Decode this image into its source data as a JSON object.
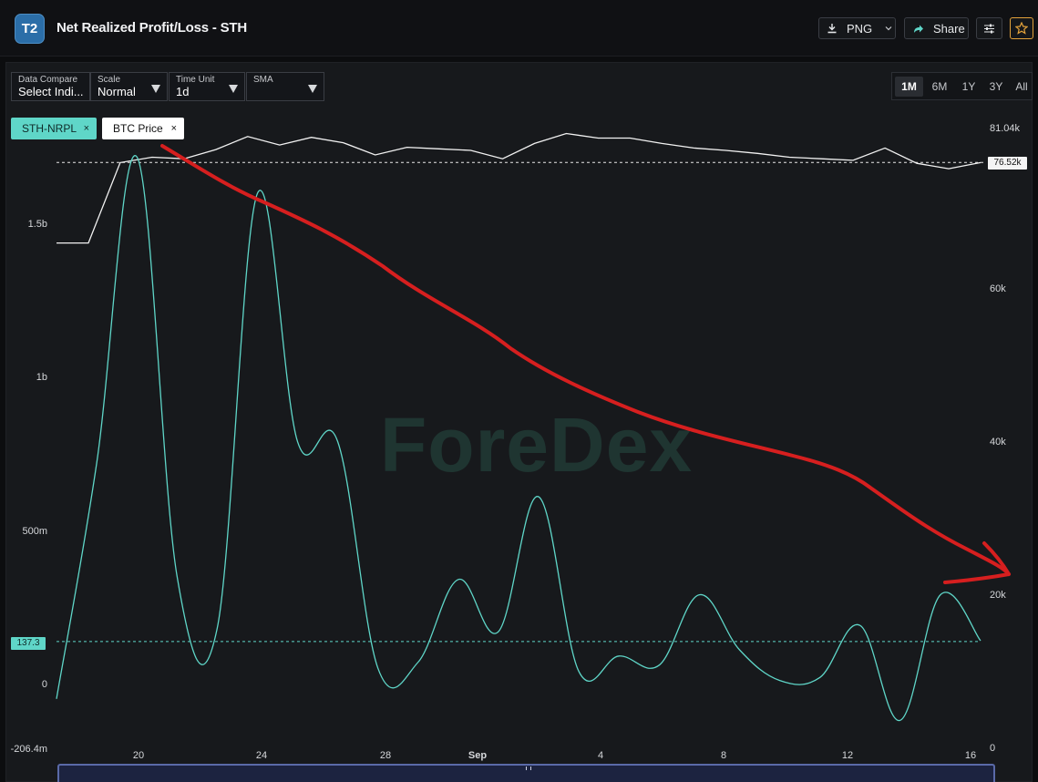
{
  "app": {
    "logo": "T2",
    "title": "Net Realized Profit/Loss - STH",
    "buttons": {
      "png": "PNG",
      "share": "Share"
    },
    "icons": [
      "download-icon",
      "chevron-down-icon",
      "share-arrow-icon",
      "settings-sliders-icon",
      "star-icon"
    ],
    "accent_color": "#e3a23b"
  },
  "controls": [
    {
      "label": "Data Compare",
      "value": "Select Indi..."
    },
    {
      "label": "Scale",
      "value": "Normal"
    },
    {
      "label": "Time Unit",
      "value": "1d"
    },
    {
      "label": "SMA",
      "value": ""
    }
  ],
  "ranges": {
    "options": [
      "1M",
      "6M",
      "1Y",
      "3Y",
      "All"
    ],
    "active": "1M"
  },
  "chips": [
    {
      "label": "STH-NRPL",
      "close": "×",
      "color": "#5fd6c8"
    },
    {
      "label": "BTC Price",
      "close": "×",
      "color": "#ffffff"
    }
  ],
  "watermark": "ForeDex",
  "chart_data": {
    "type": "line",
    "x": [
      "Aug 17",
      "Aug 18",
      "Aug 19",
      "Aug 20",
      "Aug 21",
      "Aug 22",
      "Aug 23",
      "Aug 24",
      "Aug 25",
      "Aug 26",
      "Aug 27",
      "Aug 28",
      "Aug 29",
      "Aug 30",
      "Aug 31",
      "Sep 1",
      "Sep 2",
      "Sep 3",
      "Sep 4",
      "Sep 5",
      "Sep 6",
      "Sep 7",
      "Sep 8",
      "Sep 9",
      "Sep 10",
      "Sep 11",
      "Sep 12",
      "Sep 13",
      "Sep 14",
      "Sep 15",
      "Sep 16"
    ],
    "xticks": [
      {
        "label": "20",
        "index": 3
      },
      {
        "label": "24",
        "index": 7
      },
      {
        "label": "28",
        "index": 11
      },
      {
        "label": "Sep",
        "index": 15
      },
      {
        "label": "4",
        "index": 18
      },
      {
        "label": "8",
        "index": 22
      },
      {
        "label": "12",
        "index": 26
      },
      {
        "label": "16",
        "index": 30
      }
    ],
    "series": [
      {
        "name": "STH-NRPL",
        "axis": "left",
        "color": "#5fd6c8",
        "values": [
          -0.05,
          0.72,
          1.72,
          0.35,
          0.18,
          1.6,
          0.79,
          0.79,
          0.05,
          0.07,
          0.34,
          0.17,
          0.61,
          0.04,
          0.09,
          0.06,
          0.29,
          0.11,
          0.01,
          0.02,
          0.19,
          -0.12,
          0.29,
          0.14
        ]
      },
      {
        "name": "BTC Price",
        "axis": "right",
        "color": "#ffffff",
        "values": [
          66000,
          66000,
          76500,
          77200,
          77000,
          78200,
          79900,
          78800,
          79800,
          79100,
          77500,
          78500,
          78300,
          78100,
          77000,
          79000,
          80300,
          79700,
          79700,
          79000,
          78400,
          78100,
          77700,
          77200,
          77000,
          76800,
          78400,
          76400,
          75700,
          76500
        ]
      }
    ],
    "left_axis": {
      "ticks": [
        "1.5b",
        "1b",
        "500m",
        "0",
        "-206.4m"
      ],
      "tick_values": [
        1500000000,
        1000000000,
        500000000,
        0,
        -206400000
      ],
      "ylim": [
        -206400000,
        1725000000
      ]
    },
    "right_axis": {
      "ticks": [
        "81.04k",
        "60k",
        "40k",
        "20k",
        "0"
      ],
      "tick_values": [
        81040,
        60000,
        40000,
        20000,
        0
      ],
      "ylim": [
        0,
        81040
      ]
    },
    "markers": {
      "left_last": "137.3",
      "right_last": "76.52k",
      "left_last_value": 137300000,
      "right_last_value": 76520
    },
    "annotation": {
      "type": "hand-drawn arrow",
      "color": "#d61f1f",
      "direction": "downtrend"
    },
    "grid": false
  }
}
